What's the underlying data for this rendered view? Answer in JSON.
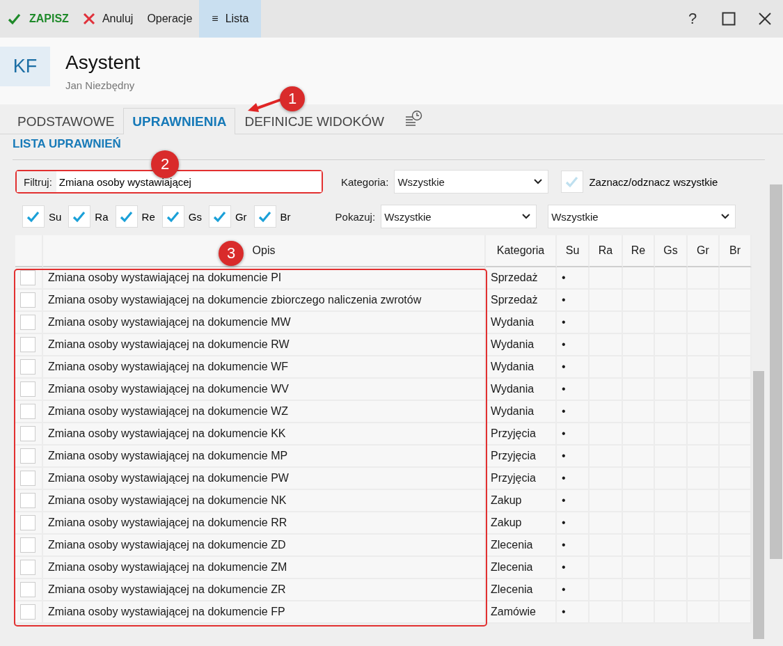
{
  "toolbar": {
    "save": "ZAPISZ",
    "cancel": "Anuluj",
    "operations": "Operacje",
    "list": {
      "icon": "≡",
      "label": "Lista",
      "selected": true
    },
    "help": "?"
  },
  "header": {
    "initials": "KF",
    "title": "Asystent",
    "subtitle": "Jan Niezbędny"
  },
  "tabs": [
    {
      "label": "PODSTAWOWE",
      "selected": false
    },
    {
      "label": "UPRAWNIENIA",
      "selected": true
    },
    {
      "label": "DEFINICJE WIDOKÓW",
      "selected": false
    }
  ],
  "section_title": "LISTA UPRAWNIEŃ",
  "filter": {
    "label": "Filtruj:",
    "value": "Zmiana osoby wystawiającej"
  },
  "category": {
    "label": "Kategoria:",
    "value": "Wszystkie"
  },
  "toggle_all": "Zaznacz/odznacz wszystkie",
  "flags": [
    {
      "label": "Su",
      "checked": true
    },
    {
      "label": "Ra",
      "checked": true
    },
    {
      "label": "Re",
      "checked": true
    },
    {
      "label": "Gs",
      "checked": true
    },
    {
      "label": "Gr",
      "checked": true
    },
    {
      "label": "Br",
      "checked": true
    }
  ],
  "show": {
    "label": "Pokazuj:",
    "value": "Wszystkie",
    "value_2": "Wszystkie"
  },
  "table": {
    "columns": [
      "Opis",
      "Kategoria",
      "Su",
      "Ra",
      "Re",
      "Gs",
      "Gr",
      "Br"
    ],
    "rows": [
      {
        "checked": false,
        "cells": [
          "Zmiana osoby wystawiającej na dokumencie PI",
          "Sprzedaż",
          "•",
          "",
          "",
          "",
          "",
          ""
        ]
      },
      {
        "checked": false,
        "cells": [
          "Zmiana osoby wystawiającej na dokumencie zbiorczego naliczenia zwrotów",
          "Sprzedaż",
          "•",
          "",
          "",
          "",
          "",
          ""
        ]
      },
      {
        "checked": false,
        "cells": [
          "Zmiana osoby wystawiającej na dokumencie MW",
          "Wydania",
          "•",
          "",
          "",
          "",
          "",
          ""
        ]
      },
      {
        "checked": false,
        "cells": [
          "Zmiana osoby wystawiającej na dokumencie RW",
          "Wydania",
          "•",
          "",
          "",
          "",
          "",
          ""
        ]
      },
      {
        "checked": false,
        "cells": [
          "Zmiana osoby wystawiającej na dokumencie WF",
          "Wydania",
          "•",
          "",
          "",
          "",
          "",
          ""
        ]
      },
      {
        "checked": false,
        "cells": [
          "Zmiana osoby wystawiającej na dokumencie WV",
          "Wydania",
          "•",
          "",
          "",
          "",
          "",
          ""
        ]
      },
      {
        "checked": false,
        "cells": [
          "Zmiana osoby wystawiającej na dokumencie WZ",
          "Wydania",
          "•",
          "",
          "",
          "",
          "",
          ""
        ]
      },
      {
        "checked": false,
        "cells": [
          "Zmiana osoby wystawiającej na dokumencie KK",
          "Przyjęcia",
          "•",
          "",
          "",
          "",
          "",
          ""
        ]
      },
      {
        "checked": false,
        "cells": [
          "Zmiana osoby wystawiającej na dokumencie MP",
          "Przyjęcia",
          "•",
          "",
          "",
          "",
          "",
          ""
        ]
      },
      {
        "checked": false,
        "cells": [
          "Zmiana osoby wystawiającej na dokumencie PW",
          "Przyjęcia",
          "•",
          "",
          "",
          "",
          "",
          ""
        ]
      },
      {
        "checked": false,
        "cells": [
          "Zmiana osoby wystawiającej na dokumencie NK",
          "Zakup",
          "•",
          "",
          "",
          "",
          "",
          ""
        ]
      },
      {
        "checked": false,
        "cells": [
          "Zmiana osoby wystawiającej na dokumencie RR",
          "Zakup",
          "•",
          "",
          "",
          "",
          "",
          ""
        ]
      },
      {
        "checked": false,
        "cells": [
          "Zmiana osoby wystawiającej na dokumencie ZD",
          "Zlecenia",
          "•",
          "",
          "",
          "",
          "",
          ""
        ]
      },
      {
        "checked": false,
        "cells": [
          "Zmiana osoby wystawiającej na dokumencie ZM",
          "Zlecenia",
          "•",
          "",
          "",
          "",
          "",
          ""
        ]
      },
      {
        "checked": false,
        "cells": [
          "Zmiana osoby wystawiającej na dokumencie ZR",
          "Zlecenia",
          "•",
          "",
          "",
          "",
          "",
          ""
        ]
      },
      {
        "checked": false,
        "cells": [
          "Zmiana osoby wystawiającej na dokumencie FP",
          "Zamówie",
          "•",
          "",
          "",
          "",
          "",
          ""
        ]
      }
    ]
  },
  "annotations": [
    "1",
    "2",
    "3"
  ]
}
